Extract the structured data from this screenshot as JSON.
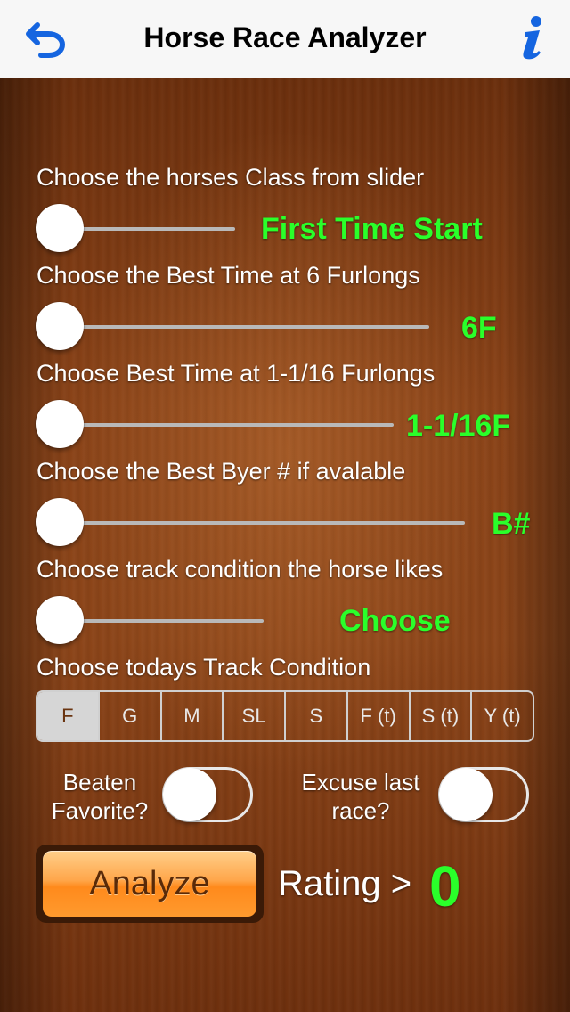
{
  "nav": {
    "title": "Horse Race Analyzer",
    "back_icon": "undo-arrow-icon",
    "info_icon": "info-icon",
    "accent": "#1565e0"
  },
  "sliders": [
    {
      "label": "Choose the horses Class from slider",
      "value": "First Time Start",
      "level": 0
    },
    {
      "label": "Choose the Best Time at 6 Furlongs",
      "value": "6F",
      "level": 0
    },
    {
      "label": "Choose Best Time at 1-1/16 Furlongs",
      "value": "1-1/16F",
      "level": 0
    },
    {
      "label": "Choose the Best Byer # if avalable",
      "value": "B#",
      "level": 0
    },
    {
      "label": "Choose track condition the horse likes",
      "value": "Choose",
      "level": 0
    }
  ],
  "track_condition": {
    "label": "Choose todays Track Condition",
    "options": [
      "F",
      "G",
      "M",
      "SL",
      "S",
      "F (t)",
      "S (t)",
      "Y (t)"
    ],
    "selected": "F"
  },
  "toggles": {
    "beaten_favorite": {
      "label_line1": "Beaten",
      "label_line2": "Favorite?",
      "on": false
    },
    "excuse_last_race": {
      "label_line1": "Excuse last",
      "label_line2": "race?",
      "on": false
    }
  },
  "analyze": {
    "label": "Analyze"
  },
  "rating": {
    "label": "Rating >",
    "value": "0"
  },
  "colors": {
    "value_green": "#2aff2a",
    "button_orange": "#ff9a2e",
    "wood": "#8a4318"
  }
}
